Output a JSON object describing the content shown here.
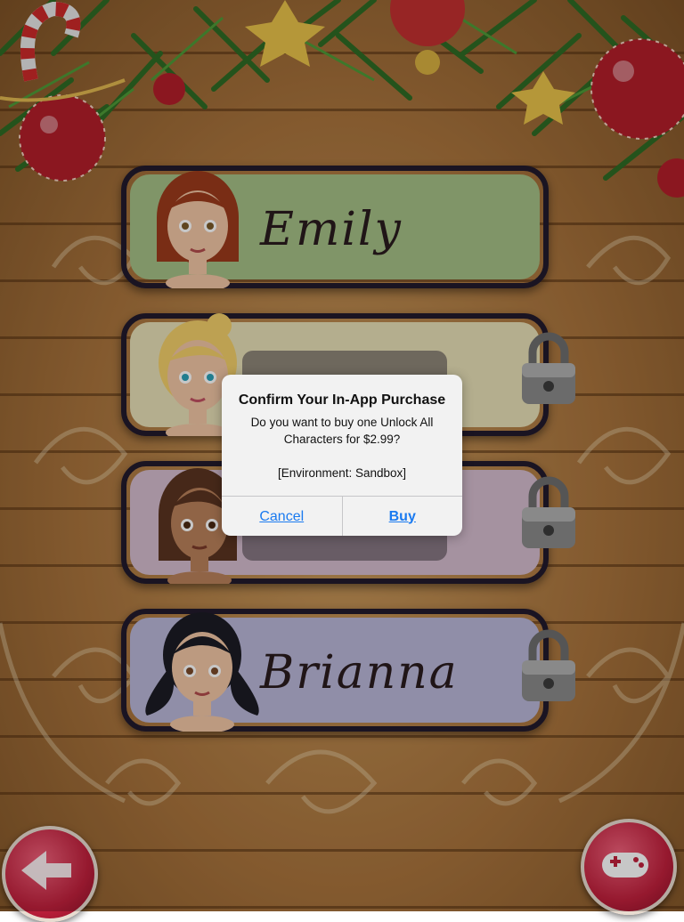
{
  "characters": [
    {
      "name": "Emily",
      "locked": false,
      "color": "#a4bf86"
    },
    {
      "name": "",
      "locked": true,
      "color": "#e7dfb6"
    },
    {
      "name": "",
      "locked": true,
      "color": "#d4bccd"
    },
    {
      "name": "Brianna",
      "locked": true,
      "color": "#b9b6d8"
    }
  ],
  "dialog": {
    "title": "Confirm Your In-App Purchase",
    "message": "Do you want to buy one Unlock All Characters for $2.99?\n\n[Environment: Sandbox]",
    "cancel_label": "Cancel",
    "buy_label": "Buy"
  },
  "icons": {
    "back": "back-arrow-icon",
    "game": "gamepad-icon",
    "lock": "padlock-icon"
  },
  "colors": {
    "accent_link": "#1a7af0",
    "round_button": "#c0203c"
  }
}
